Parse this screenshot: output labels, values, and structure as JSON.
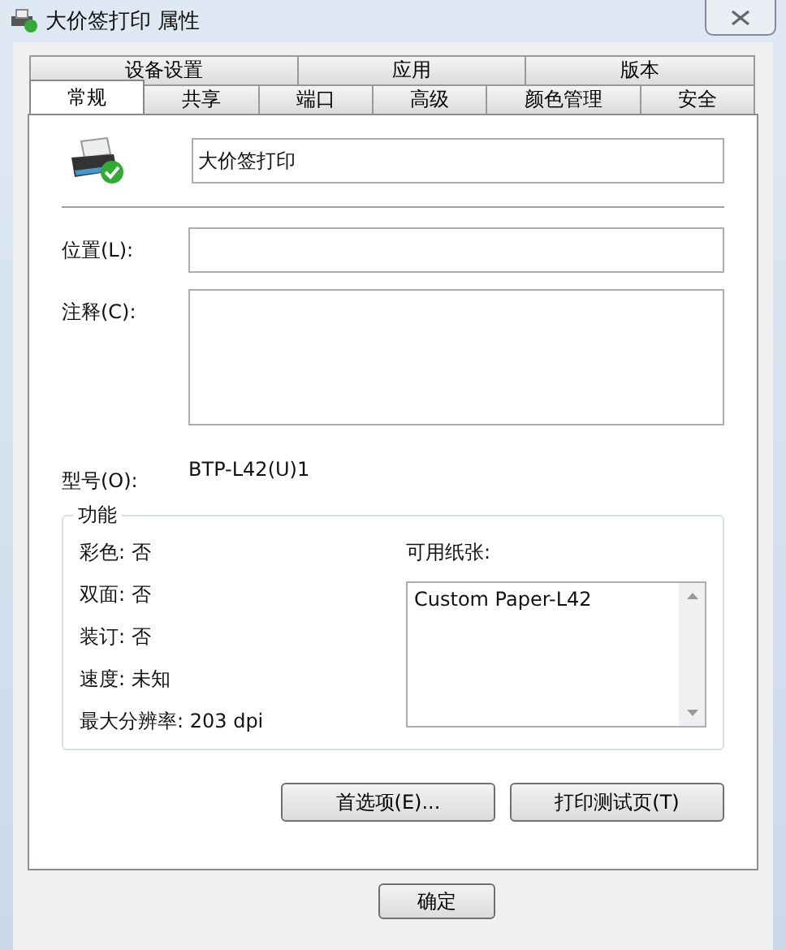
{
  "window": {
    "title": "大价签打印 属性"
  },
  "tab_rows": [
    [
      {
        "label": "设备设置",
        "selected": false
      },
      {
        "label": "应用",
        "selected": false
      },
      {
        "label": "版本",
        "selected": false
      }
    ],
    [
      {
        "label": "常规",
        "selected": true
      },
      {
        "label": "共享",
        "selected": false
      },
      {
        "label": "端口",
        "selected": false
      },
      {
        "label": "高级",
        "selected": false
      },
      {
        "label": "颜色管理",
        "selected": false
      },
      {
        "label": "安全",
        "selected": false
      }
    ]
  ],
  "printer_name": {
    "value": "大价签打印"
  },
  "location": {
    "label": "位置(L):"
  },
  "comment": {
    "label": "注释(C):"
  },
  "model": {
    "label": "型号(O):",
    "value": "BTP-L42(U)1"
  },
  "features": {
    "title": "功能",
    "items": [
      "彩色: 否",
      "双面: 否",
      "装订: 否",
      "速度: 未知",
      "最大分辨率: 203 dpi"
    ],
    "paper_label": "可用纸张:",
    "papers": [
      "Custom Paper-L42"
    ]
  },
  "panel_buttons": [
    "首选项(E)...",
    "打印测试页(T)"
  ],
  "dialog_buttons": [
    "确定"
  ]
}
